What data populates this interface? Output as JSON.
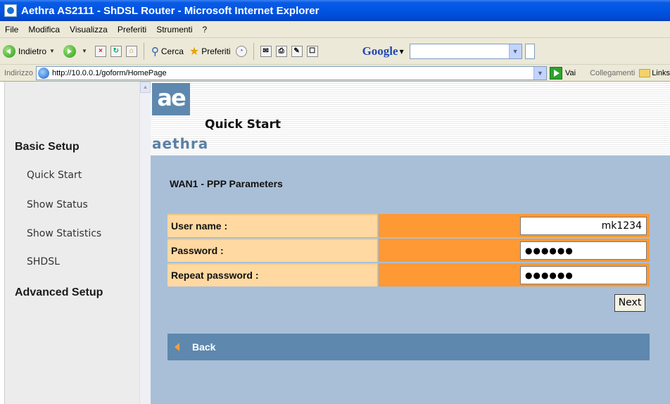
{
  "window": {
    "title": "Aethra AS2111 - ShDSL Router - Microsoft Internet Explorer"
  },
  "menu": [
    "File",
    "Modifica",
    "Visualizza",
    "Preferiti",
    "Strumenti",
    "?"
  ],
  "toolbar": {
    "back_label": "Indietro",
    "search_label": "Cerca",
    "favorites_label": "Preferiti",
    "google_logo": "Google",
    "google_caret": "▾"
  },
  "address": {
    "label": "Indirizzo",
    "url": "http://10.0.0.1/goform/HomePage",
    "go_label": "Vai",
    "links_prefix": "Collegamenti",
    "links_label": "Links"
  },
  "sidebar": {
    "basic_setup": "Basic Setup",
    "items": [
      {
        "label": "Quick Start"
      },
      {
        "label": "Show Status"
      },
      {
        "label": "Show Statistics"
      },
      {
        "label": "SHDSL"
      }
    ],
    "advanced_setup": "Advanced Setup"
  },
  "header": {
    "logo_mark": "ae",
    "logo_text": "aethra",
    "page_title": "Quick Start"
  },
  "form": {
    "section_title": "WAN1 - PPP Parameters",
    "fields": [
      {
        "label": "User name :",
        "value": "mk1234"
      },
      {
        "label": "Password :",
        "value": "●●●●●●"
      },
      {
        "label": "Repeat password :",
        "value": "●●●●●●"
      }
    ],
    "next_label": "Next",
    "back_label": "Back"
  },
  "colors": {
    "label_bg": "#FFD9A1",
    "value_bg": "#FF9933",
    "panel_bg": "#A9BFD7",
    "bar_bg": "#5E88AE"
  }
}
